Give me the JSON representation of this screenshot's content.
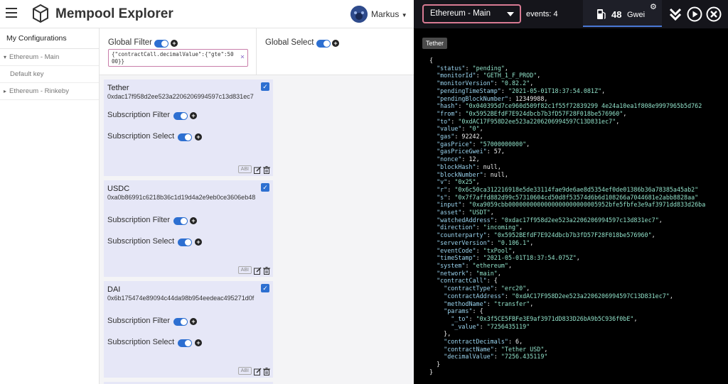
{
  "app": {
    "title": "Mempool Explorer",
    "user": "Markus"
  },
  "sidebar": {
    "heading": "My Configurations",
    "items": [
      {
        "label": "Ethereum - Main",
        "caret": "▾"
      },
      {
        "label": "Default key"
      },
      {
        "label": "Ethereum - Rinkeby",
        "caret": "▸"
      }
    ]
  },
  "global": {
    "filter_label": "Global Filter",
    "select_label": "Global Select",
    "filter_chip": "{\"contractCall.decimalValue\":{\"gte\":5000}}",
    "chip_close": "×"
  },
  "subscriptions": [
    {
      "name": "Tether",
      "address": "0xdac17f958d2ee523a2206206994597c13d831ec7",
      "filter_label": "Subscription Filter",
      "select_label": "Subscription Select",
      "abi": "ABI"
    },
    {
      "name": "USDC",
      "address": "0xa0b86991c6218b36c1d19d4a2e9eb0ce3606eb48",
      "filter_label": "Subscription Filter",
      "select_label": "Subscription Select",
      "abi": "ABI"
    },
    {
      "name": "DAI",
      "address": "0x6b175474e89094c44da98b954eedeac495271d0f",
      "filter_label": "Subscription Filter",
      "select_label": "Subscription Select",
      "abi": "ABI"
    }
  ],
  "topbar": {
    "network": "Ethereum - Main",
    "events_label": "events:",
    "events_count": "4",
    "gas_value": "48",
    "gas_unit": "Gwei"
  },
  "event_tag": "Tether",
  "colors": {
    "accent": "#2d6fd1",
    "network_border": "#d87a93",
    "card_bg": "#e6e7f7"
  },
  "icons": [
    "menu-icon",
    "logo-icon",
    "avatar-icon",
    "caret-down-icon",
    "plus-icon",
    "close-icon",
    "check-icon",
    "edit-icon",
    "trash-icon",
    "gas-pump-icon",
    "gear-icon",
    "collapse-icon",
    "play-icon",
    "close-circle-icon"
  ],
  "event_lines": [
    {
      "t": "p",
      "v": "{"
    },
    {
      "t": "kv",
      "ind": 1,
      "k": "\"status\"",
      "v": "\"pending\"",
      "vt": "s",
      "c": ","
    },
    {
      "t": "kv",
      "ind": 1,
      "k": "\"monitorId\"",
      "v": "\"GETH_1_F_PROD\"",
      "vt": "s",
      "c": ","
    },
    {
      "t": "kv",
      "ind": 1,
      "k": "\"monitorVersion\"",
      "v": "\"0.82.2\"",
      "vt": "s",
      "c": ","
    },
    {
      "t": "kv",
      "ind": 1,
      "k": "\"pendingTimeStamp\"",
      "v": "\"2021-05-01T18:37:54.081Z\"",
      "vt": "s",
      "c": ","
    },
    {
      "t": "kv",
      "ind": 1,
      "k": "\"pendingBlockNumber\"",
      "v": "12349988",
      "vt": "n",
      "c": ","
    },
    {
      "t": "kv",
      "ind": 1,
      "k": "\"hash\"",
      "v": "\"0x040395d7ce960d509f82c1f55f72839299 4e24a10ea1f808e9997965b5d762",
      "vt": "s",
      "c": ""
    },
    {
      "t": "kv",
      "ind": 1,
      "k": "\"from\"",
      "v": "\"0x5952BEfdF7E924dbcb7b3fD57F28F018be576960\"",
      "vt": "s",
      "c": ","
    },
    {
      "t": "kv",
      "ind": 1,
      "k": "\"to\"",
      "v": "\"0xdAC17F958D2ee523a2206206994597C13D831ec7\"",
      "vt": "s",
      "c": ","
    },
    {
      "t": "kv",
      "ind": 1,
      "k": "\"value\"",
      "v": "\"0\"",
      "vt": "s",
      "c": ","
    },
    {
      "t": "kv",
      "ind": 1,
      "k": "\"gas\"",
      "v": "92242",
      "vt": "n",
      "c": ","
    },
    {
      "t": "kv",
      "ind": 1,
      "k": "\"gasPrice\"",
      "v": "\"57000000000\"",
      "vt": "s",
      "c": ","
    },
    {
      "t": "kv",
      "ind": 1,
      "k": "\"gasPriceGwei\"",
      "v": "57",
      "vt": "n",
      "c": ","
    },
    {
      "t": "kv",
      "ind": 1,
      "k": "\"nonce\"",
      "v": "12",
      "vt": "n",
      "c": ","
    },
    {
      "t": "kv",
      "ind": 1,
      "k": "\"blockHash\"",
      "v": "null",
      "vt": "n",
      "c": ","
    },
    {
      "t": "kv",
      "ind": 1,
      "k": "\"blockNumber\"",
      "v": "null",
      "vt": "n",
      "c": ","
    },
    {
      "t": "kv",
      "ind": 1,
      "k": "\"v\"",
      "v": "\"0x25\"",
      "vt": "s",
      "c": ","
    },
    {
      "t": "kv",
      "ind": 1,
      "k": "\"r\"",
      "v": "\"0x6c50ca312216918e5de33114fae9de6ae8d5354ef0de01386b36a78385a45ab2\"",
      "vt": "s",
      "c": ""
    },
    {
      "t": "kv",
      "ind": 1,
      "k": "\"s\"",
      "v": "\"0x7f7affd882d99c57310604cd50d8f53574d6b6d108266a7044681e2abb8828aa\"",
      "vt": "s",
      "c": ""
    },
    {
      "t": "kv",
      "ind": 1,
      "k": "\"input\"",
      "v": "\"0xa9059cbb0000000000000000000000005952bfe5fbfe3e9af3971dd833d26ba",
      "vt": "s",
      "c": ""
    },
    {
      "t": "kv",
      "ind": 1,
      "k": "\"asset\"",
      "v": "\"USDT\"",
      "vt": "s",
      "c": ","
    },
    {
      "t": "kv",
      "ind": 1,
      "k": "\"watchedAddress\"",
      "v": "\"0xdac17f958d2ee523a2206206994597c13d831ec7\"",
      "vt": "s",
      "c": ","
    },
    {
      "t": "kv",
      "ind": 1,
      "k": "\"direction\"",
      "v": "\"incoming\"",
      "vt": "s",
      "c": ","
    },
    {
      "t": "kv",
      "ind": 1,
      "k": "\"counterparty\"",
      "v": "\"0x5952BEfdF7E924dbcb7b3fD57F28F018be576960\"",
      "vt": "s",
      "c": ","
    },
    {
      "t": "kv",
      "ind": 1,
      "k": "\"serverVersion\"",
      "v": "\"0.106.1\"",
      "vt": "s",
      "c": ","
    },
    {
      "t": "kv",
      "ind": 1,
      "k": "\"eventCode\"",
      "v": "\"txPool\"",
      "vt": "s",
      "c": ","
    },
    {
      "t": "kv",
      "ind": 1,
      "k": "\"timeStamp\"",
      "v": "\"2021-05-01T18:37:54.075Z\"",
      "vt": "s",
      "c": ","
    },
    {
      "t": "kv",
      "ind": 1,
      "k": "\"system\"",
      "v": "\"ethereum\"",
      "vt": "s",
      "c": ","
    },
    {
      "t": "kv",
      "ind": 1,
      "k": "\"network\"",
      "v": "\"main\"",
      "vt": "s",
      "c": ","
    },
    {
      "t": "ko",
      "ind": 1,
      "k": "\"contractCall\"",
      "v": "{"
    },
    {
      "t": "kv",
      "ind": 2,
      "k": "\"contractType\"",
      "v": "\"erc20\"",
      "vt": "s",
      "c": ","
    },
    {
      "t": "kv",
      "ind": 2,
      "k": "\"contractAddress\"",
      "v": "\"0xdAC17F958D2ee523a2206206994597C13D831ec7\"",
      "vt": "s",
      "c": ","
    },
    {
      "t": "kv",
      "ind": 2,
      "k": "\"methodName\"",
      "v": "\"transfer\"",
      "vt": "s",
      "c": ","
    },
    {
      "t": "ko",
      "ind": 2,
      "k": "\"params\"",
      "v": "{"
    },
    {
      "t": "kv",
      "ind": 3,
      "k": "\"_to\"",
      "v": "\"0x3f5CE5FBFe3E9af3971dD833D26bA9b5C936f0bE\"",
      "vt": "s",
      "c": ","
    },
    {
      "t": "kv",
      "ind": 3,
      "k": "\"_value\"",
      "v": "\"7256435119\"",
      "vt": "s",
      "c": ""
    },
    {
      "t": "p",
      "ind": 2,
      "v": "},"
    },
    {
      "t": "kv",
      "ind": 2,
      "k": "\"contractDecimals\"",
      "v": "6",
      "vt": "n",
      "c": ","
    },
    {
      "t": "kv",
      "ind": 2,
      "k": "\"contractName\"",
      "v": "\"Tether USD\"",
      "vt": "s",
      "c": ","
    },
    {
      "t": "kv",
      "ind": 2,
      "k": "\"decimalValue\"",
      "v": "\"7256.435119\"",
      "vt": "s",
      "c": ""
    },
    {
      "t": "p",
      "ind": 1,
      "v": "}"
    },
    {
      "t": "p",
      "v": "}"
    }
  ]
}
